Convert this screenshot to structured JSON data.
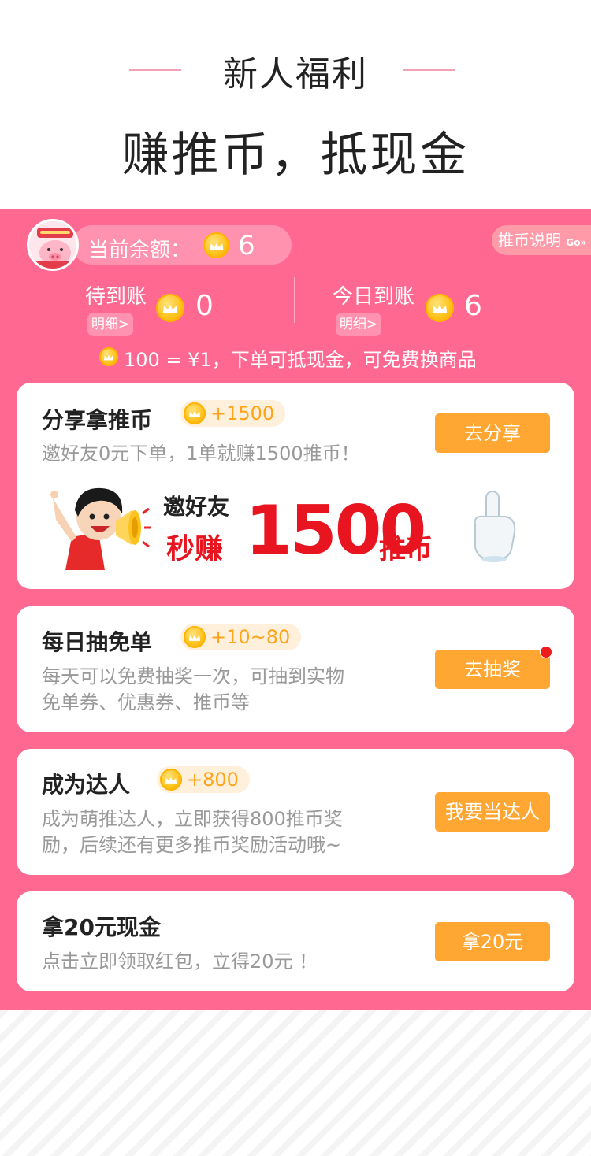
{
  "hero": {
    "subtitle": "新人福利",
    "title": "赚推币，抵现金"
  },
  "balance": {
    "label": "当前余额：",
    "value": "6"
  },
  "explain": {
    "label": "推币说明",
    "go": "Go»"
  },
  "stats": {
    "pending": {
      "label": "待到账",
      "value": "0",
      "detail": "明细>"
    },
    "today": {
      "label": "今日到账",
      "value": "6",
      "detail": "明细>"
    }
  },
  "rule_text": "100 = ¥1，下单可抵现金，可免费换商品",
  "tasks": [
    {
      "title": "分享拿推币",
      "reward": "+1500",
      "desc": "邀好友0元下单，1单就赚1500推币！",
      "button": "去分享"
    },
    {
      "title": "每日抽免单",
      "reward": "+10~80",
      "desc_lines": [
        "每天可以免费抽奖一次，可抽到实物",
        "免单券、优惠券、推币等"
      ],
      "button": "去抽奖"
    },
    {
      "title": "成为达人",
      "reward": "+800",
      "desc_lines": [
        "成为萌推达人，立即获得800推币奖",
        "励，后续还有更多推币奖励活动哦~"
      ],
      "button": "我要当达人"
    },
    {
      "title": "拿20元现金",
      "desc": "点击立即领取红包，立得20元 ！",
      "button": "拿20元"
    }
  ],
  "banner": {
    "invite": "邀好友",
    "earn": "秒赚",
    "amount": "1500",
    "unit": "推币"
  },
  "colors": {
    "pink": "#ff6991",
    "orange_button": "#ffa633",
    "banner_red": "#e8141f"
  }
}
